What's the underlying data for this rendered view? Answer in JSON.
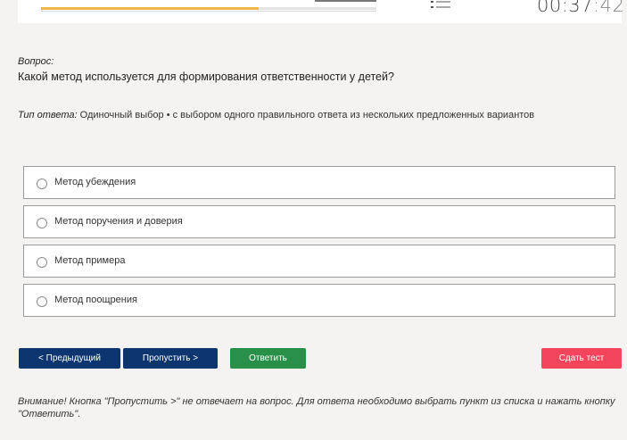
{
  "progress": {
    "fraction": 0.65
  },
  "timer": {
    "main": "00:37",
    "seconds": ":42"
  },
  "question": {
    "label": "Вопрос:",
    "text": "Какой метод используется для формирования ответственности у детей?"
  },
  "answer_type": {
    "label": "Тип ответа:",
    "text": " Одиночный выбор • с выбором одного правильного ответа из нескольких предложенных вариантов"
  },
  "options": [
    {
      "label": "Метод убеждения"
    },
    {
      "label": "Метод поручения и доверия"
    },
    {
      "label": "Метод примера"
    },
    {
      "label": "Метод поощрения"
    }
  ],
  "buttons": {
    "prev": "< Предыдущий",
    "skip": "Пропустить >",
    "answer": "Ответить",
    "finish": "Сдать тест"
  },
  "colors": {
    "navy": "#0d3670",
    "green": "#289049",
    "red": "#f2455c",
    "progress": "#f0b64a"
  },
  "icons": {
    "question_list": "list-icon"
  },
  "warning": "Внимание! Кнопка \"Пропустить >\" не отвечает на вопрос. Для ответа необходимо выбрать пункт из списка и нажать кнопку \"Ответить\"."
}
